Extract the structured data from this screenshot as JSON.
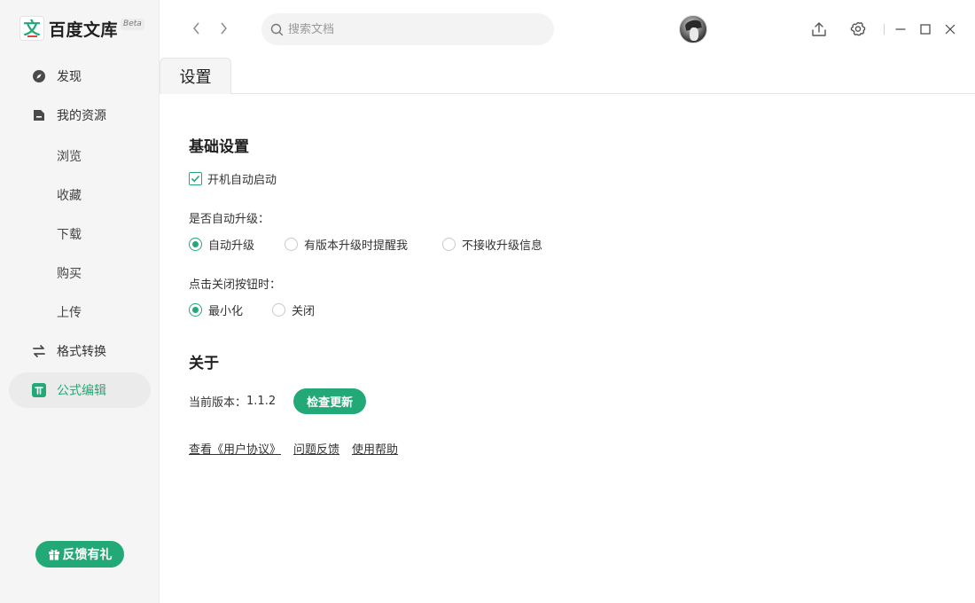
{
  "app": {
    "logo_glyph": "文",
    "name": "百度文库",
    "badge": "Beta"
  },
  "sidebar": {
    "items": [
      {
        "label": "发现",
        "icon": "compass-icon"
      },
      {
        "label": "我的资源",
        "icon": "folder-icon"
      },
      {
        "label": "格式转换",
        "icon": "swap-arrows-icon"
      },
      {
        "label": "公式编辑",
        "icon": "pi-icon"
      }
    ],
    "sub_items": [
      "浏览",
      "收藏",
      "下载",
      "购买",
      "上传"
    ],
    "active": "公式编辑",
    "feedback_label": "反馈有礼"
  },
  "search": {
    "placeholder": "搜索文档",
    "value": ""
  },
  "tabs": [
    {
      "label": "设置",
      "active": true
    }
  ],
  "settings": {
    "basic": {
      "title": "基础设置",
      "autostart_label": "开机自动启动",
      "autostart_checked": true,
      "upgrade_label": "是否自动升级：",
      "upgrade_options": [
        "自动升级",
        "有版本升级时提醒我",
        "不接收升级信息"
      ],
      "upgrade_selected": "自动升级",
      "close_label": "点击关闭按钮时：",
      "close_options": [
        "最小化",
        "关闭"
      ],
      "close_selected": "最小化"
    },
    "about": {
      "title": "关于",
      "version_label": "当前版本：",
      "version": "1.1.2",
      "check_update_label": "检查更新",
      "links": [
        "查看《用户协议》",
        "问题反馈",
        "使用帮助"
      ]
    }
  },
  "colors": {
    "accent": "#23a978",
    "sidebar_bg": "#f5f5f5",
    "logo_red": "#e0453a"
  }
}
